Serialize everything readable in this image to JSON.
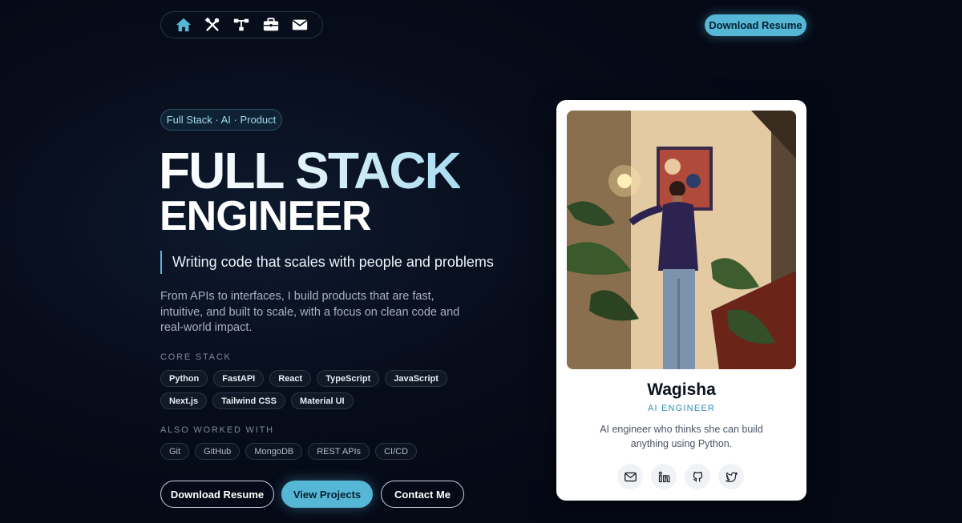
{
  "nav": {
    "icons": [
      "home-icon",
      "tools-icon",
      "sitemap-icon",
      "briefcase-icon",
      "envelope-icon"
    ]
  },
  "header": {
    "resume_label": "Download Resume"
  },
  "hero": {
    "tagline": "Full Stack · AI · Product",
    "title_line1": "FULL STACK",
    "title_line2": "ENGINEER",
    "quote": "Writing code that scales with people and problems",
    "description": "From APIs to interfaces, I build products that are fast, intuitive, and built to scale, with a focus on clean code and real-world impact."
  },
  "core_stack": {
    "label": "CORE STACK",
    "row1": [
      "Python",
      "FastAPI",
      "React",
      "TypeScript",
      "JavaScript"
    ],
    "row2": [
      "Next.js",
      "Tailwind CSS",
      "Material UI"
    ]
  },
  "also": {
    "label": "ALSO WORKED WITH",
    "items": [
      "Git",
      "GitHub",
      "MongoDB",
      "REST APIs",
      "CI/CD"
    ]
  },
  "actions": {
    "download": "Download Resume",
    "projects": "View Projects",
    "contact": "Contact Me"
  },
  "profile": {
    "name": "Wagisha",
    "role": "AI ENGINEER",
    "bio": "AI engineer who thinks she can build anything using Python.",
    "social_icons": [
      "mail-icon",
      "linkedin-icon",
      "github-icon",
      "twitter-icon"
    ]
  },
  "colors": {
    "accent": "#56b6d6",
    "background": "#070c1a",
    "card": "#ffffff"
  }
}
